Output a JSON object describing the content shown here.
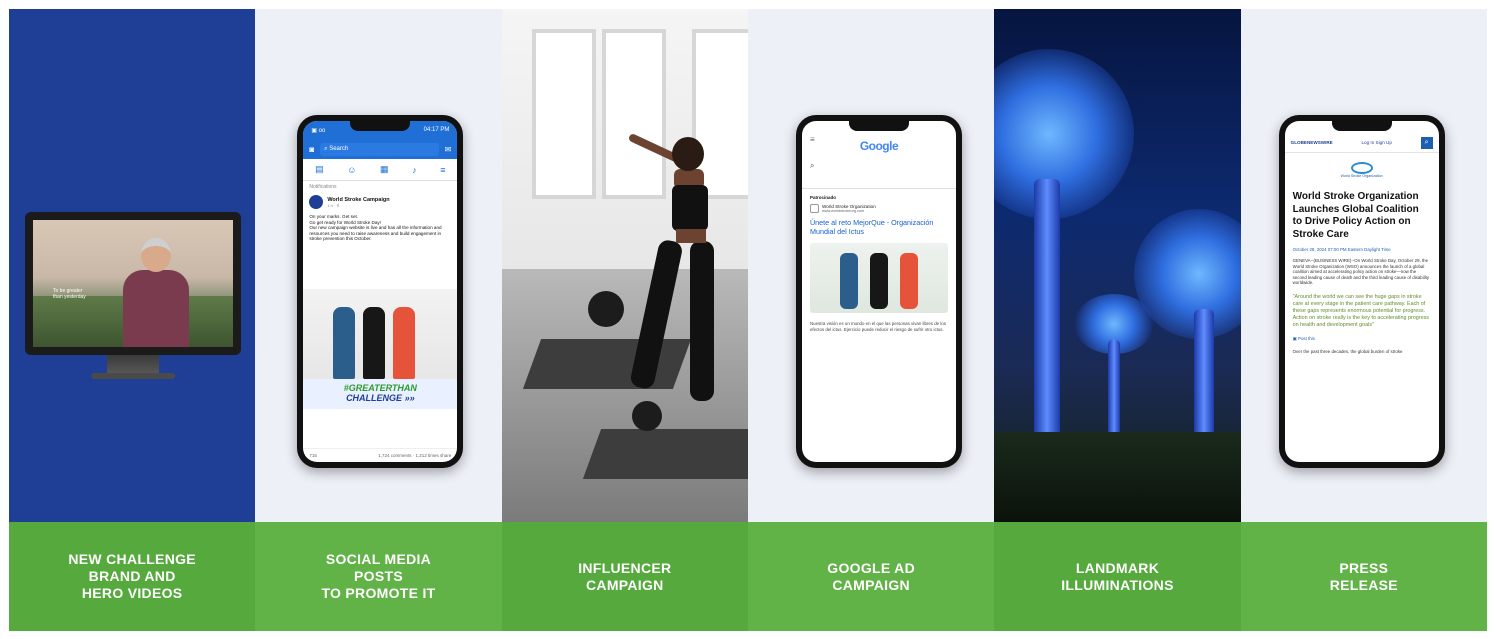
{
  "panels": [
    {
      "caption": "NEW CHALLENGE\nBRAND AND\nHERO VIDEOS"
    },
    {
      "caption": "SOCIAL MEDIA POSTS\nTO PROMOTE IT"
    },
    {
      "caption": "INFLUENCER\nCAMPAIGN"
    },
    {
      "caption": "GOOGLE AD\nCAMPAIGN"
    },
    {
      "caption": "LANDMARK\nILLUMINATIONS"
    },
    {
      "caption": "PRESS\nRELEASE"
    }
  ],
  "video": {
    "tagline": "To be greater than yesterday"
  },
  "facebook": {
    "status_left": "▣ oo",
    "status_right": "04:17 PM",
    "search": "Search",
    "notifications": "Notifications",
    "page_name": "World Stroke Campaign",
    "post_time": "1 h · ⚲",
    "post_text": "On your marks. Get set.\nGo get ready for World Stroke Day!\nOur new campaign website is live and has all the information and resources you need to raise awareness and build engagement in stroke prevention this October.",
    "hashtag_line1": "#GREATERTHAN",
    "hashtag_line2": "CHALLENGE »»",
    "reactions": "715",
    "comments": "1,724 comments · 1,212 times share"
  },
  "google": {
    "logo": "Google",
    "sponsored": "Patrocinado",
    "org_name": "World Stroke Organization",
    "org_url": "www.worldstrokeorg.com",
    "ad_title": "Únete al reto MejorQue - Organización Mundial del Ictus",
    "ad_desc": "Nuestra visión es un mundo en el que las personas vivan libres de los efectos del ictus. Ejercicio puede reducir el riesgo de sufrir otro ictus."
  },
  "press": {
    "site": "GLOBENEWSWIRE",
    "login": "Log In   Sign Up",
    "org_logo": "World Stroke Organization",
    "headline": "World Stroke Organization Launches Global Coalition to Drive Policy Action on Stroke Care",
    "date": "October 28, 2024 07:00 PM Eastern Daylight Time",
    "body": "GENEVA--(BUSINESS WIRE)--On World Stroke Day, October 29, the World Stroke Organization (WSO) announces the launch of a global coalition aimed at accelerating policy action on stroke—now the second leading cause of death and the third leading cause of disability worldwide.",
    "quote": "\"Around the world we can see the huge gaps in stroke care at every stage in the patient care pathway. Each of these gaps represents enormous potential for progress. Action on stroke really is the key to accelerating progress on health and development goals\"",
    "share": "Post this",
    "tail": "Over the past three decades, the global burden of stroke"
  }
}
